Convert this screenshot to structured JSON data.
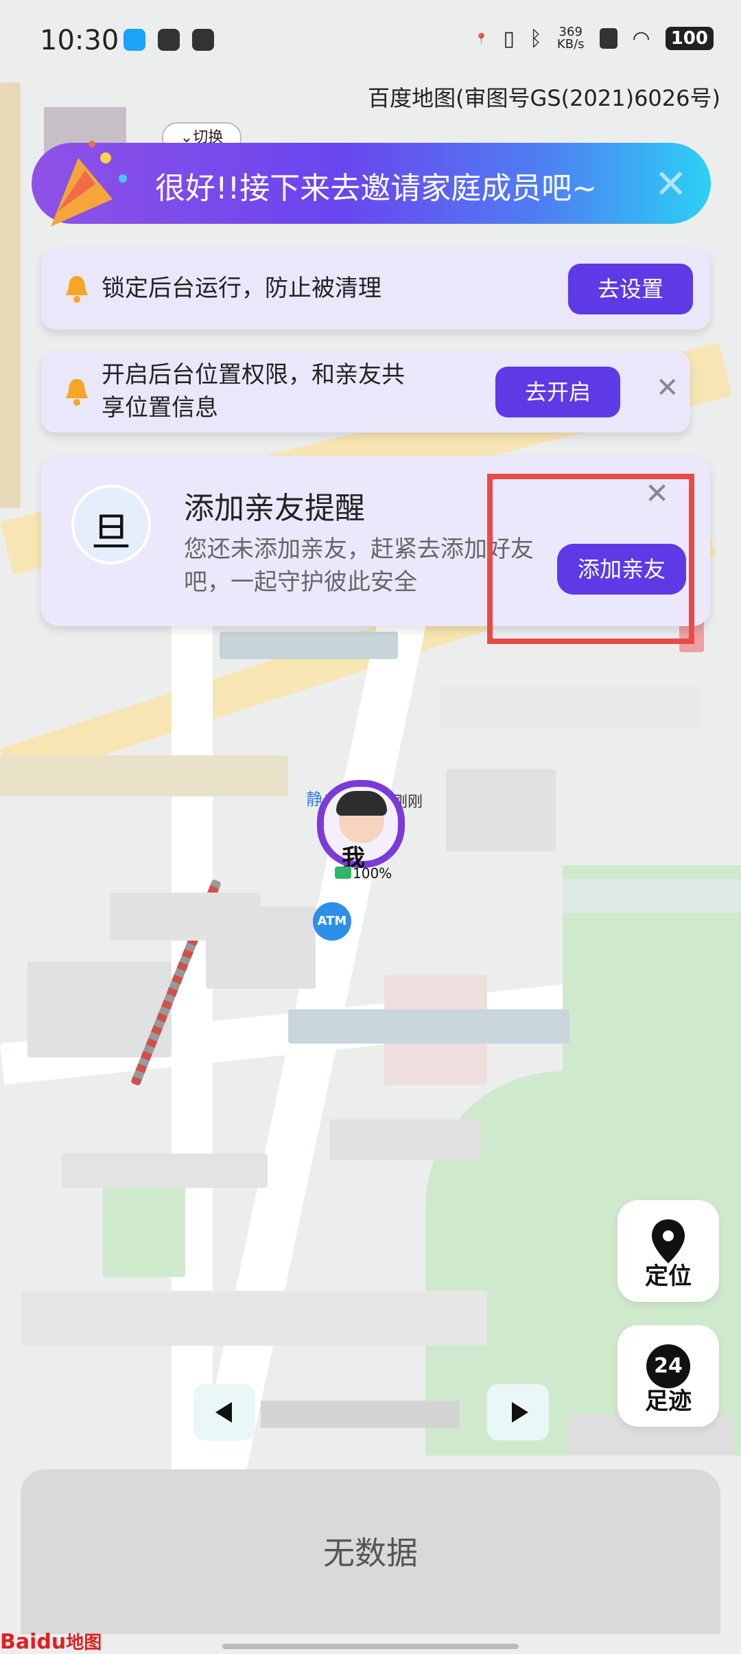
{
  "status_bar": {
    "time": "10:30",
    "speed_value": "369",
    "speed_unit": "KB/s",
    "battery": "100"
  },
  "map": {
    "copyright": "百度地图(审图号GS(2021)6026号)",
    "switch_label": "切换",
    "user_name": "我",
    "user_status": "静止",
    "user_time": "刚刚",
    "battery": "100%",
    "atm": "ATM"
  },
  "banner": {
    "text": "很好!!接下来去邀请家庭成员吧~"
  },
  "reminder1": {
    "text": "锁定后台运行，防止被清理",
    "button": "去设置"
  },
  "reminder2": {
    "line1": "开启后台位置权限，和亲友共",
    "line2": "享位置信息",
    "button": "去开启"
  },
  "friend_reminder": {
    "icon_char": "旦",
    "title": "添加亲友提醒",
    "desc": "您还未添加亲友，赶紧去添加好友吧，一起守护彼此安全",
    "button": "添加亲友"
  },
  "controls": {
    "locate": "定位",
    "track": "足迹",
    "track_badge": "24"
  },
  "sheet": {
    "empty_text": "无数据"
  },
  "footer": {
    "baidu_text": "Baidu",
    "map_text": "地图"
  },
  "colors": {
    "accent": "#5d3ae6",
    "card_bg": "#ebe7fb",
    "highlight": "#e84a4a"
  }
}
